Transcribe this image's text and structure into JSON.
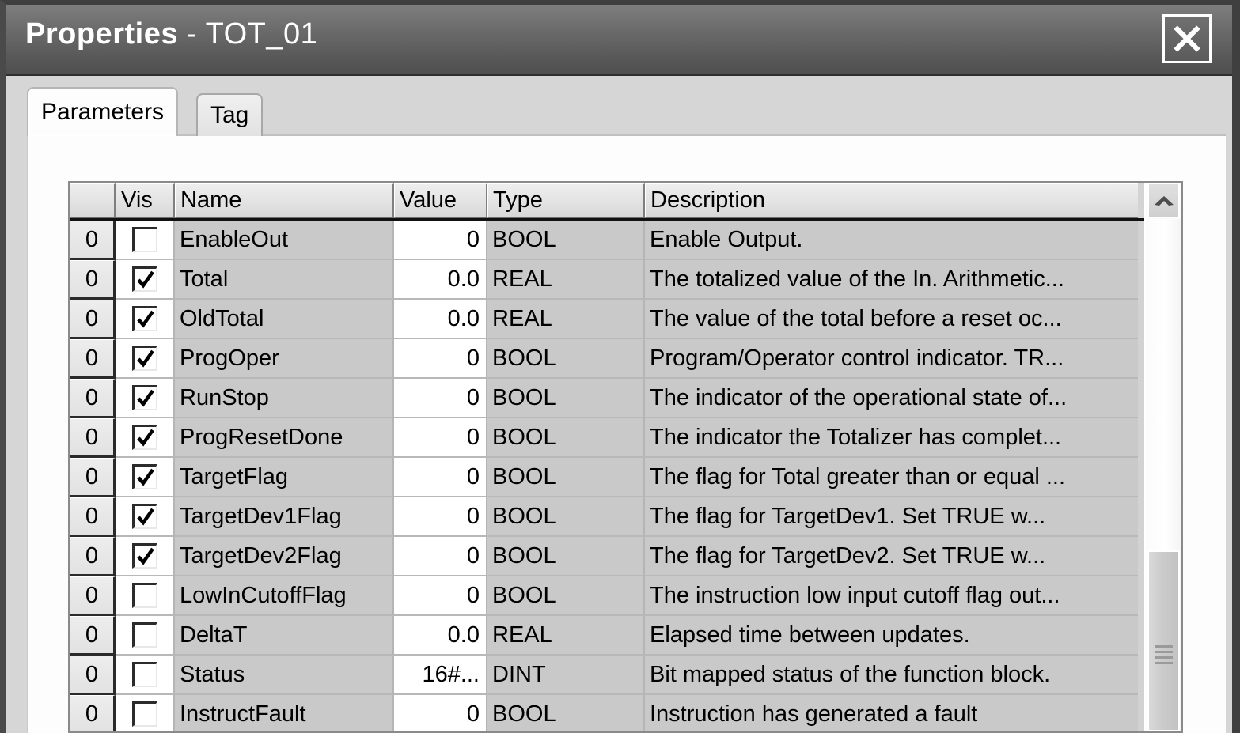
{
  "window": {
    "title_prefix": "Properties",
    "title_separator": " - ",
    "title_name": "TOT_01",
    "close_label": "Close"
  },
  "tabs": [
    {
      "label": "Parameters",
      "active": true
    },
    {
      "label": "Tag",
      "active": false
    }
  ],
  "grid": {
    "columns": [
      {
        "key": "rowhdr",
        "label": ""
      },
      {
        "key": "vis",
        "label": "Vis"
      },
      {
        "key": "name",
        "label": "Name"
      },
      {
        "key": "value",
        "label": "Value"
      },
      {
        "key": "type",
        "label": "Type"
      },
      {
        "key": "desc",
        "label": "Description"
      }
    ],
    "rows": [
      {
        "rowhdr": "0",
        "vis": false,
        "name": "EnableOut",
        "value": "0",
        "type": "BOOL",
        "desc": "Enable Output."
      },
      {
        "rowhdr": "0",
        "vis": true,
        "name": "Total",
        "value": "0.0",
        "type": "REAL",
        "desc": "The totalized value of the In.  Arithmetic..."
      },
      {
        "rowhdr": "0",
        "vis": true,
        "name": "OldTotal",
        "value": "0.0",
        "type": "REAL",
        "desc": "The value of the total before a reset oc..."
      },
      {
        "rowhdr": "0",
        "vis": true,
        "name": "ProgOper",
        "value": "0",
        "type": "BOOL",
        "desc": "Program/Operator control indicator.  TR..."
      },
      {
        "rowhdr": "0",
        "vis": true,
        "name": "RunStop",
        "value": "0",
        "type": "BOOL",
        "desc": "The indicator of the operational state of..."
      },
      {
        "rowhdr": "0",
        "vis": true,
        "name": "ProgResetDone",
        "value": "0",
        "type": "BOOL",
        "desc": "The indicator the Totalizer has complet..."
      },
      {
        "rowhdr": "0",
        "vis": true,
        "name": "TargetFlag",
        "value": "0",
        "type": "BOOL",
        "desc": "The flag for Total greater than or equal ..."
      },
      {
        "rowhdr": "0",
        "vis": true,
        "name": "TargetDev1Flag",
        "value": "0",
        "type": "BOOL",
        "desc": "The flag for TargetDev1.  Set TRUE w..."
      },
      {
        "rowhdr": "0",
        "vis": true,
        "name": "TargetDev2Flag",
        "value": "0",
        "type": "BOOL",
        "desc": "The flag for TargetDev2.  Set TRUE w..."
      },
      {
        "rowhdr": "0",
        "vis": false,
        "name": "LowInCutoffFlag",
        "value": "0",
        "type": "BOOL",
        "desc": "The instruction low input cutoff flag out..."
      },
      {
        "rowhdr": "0",
        "vis": false,
        "name": "DeltaT",
        "value": "0.0",
        "type": "REAL",
        "desc": "Elapsed time between updates."
      },
      {
        "rowhdr": "0",
        "vis": false,
        "name": "Status",
        "value": "16#...",
        "type": "DINT",
        "desc": "Bit mapped status of the function block."
      },
      {
        "rowhdr": "0",
        "vis": false,
        "name": "InstructFault",
        "value": "0",
        "type": "BOOL",
        "desc": "Instruction has generated a fault"
      }
    ]
  },
  "scrollbar": {
    "up_arrow": "scroll-up",
    "thumb": "scroll-thumb"
  },
  "colors": {
    "titlebar": "#5a5a5a",
    "dialog_face": "#d6d6d6",
    "grid_row": "#c9c9c9",
    "grid_header": "#e3e3e3",
    "value_cell": "#ffffff"
  }
}
